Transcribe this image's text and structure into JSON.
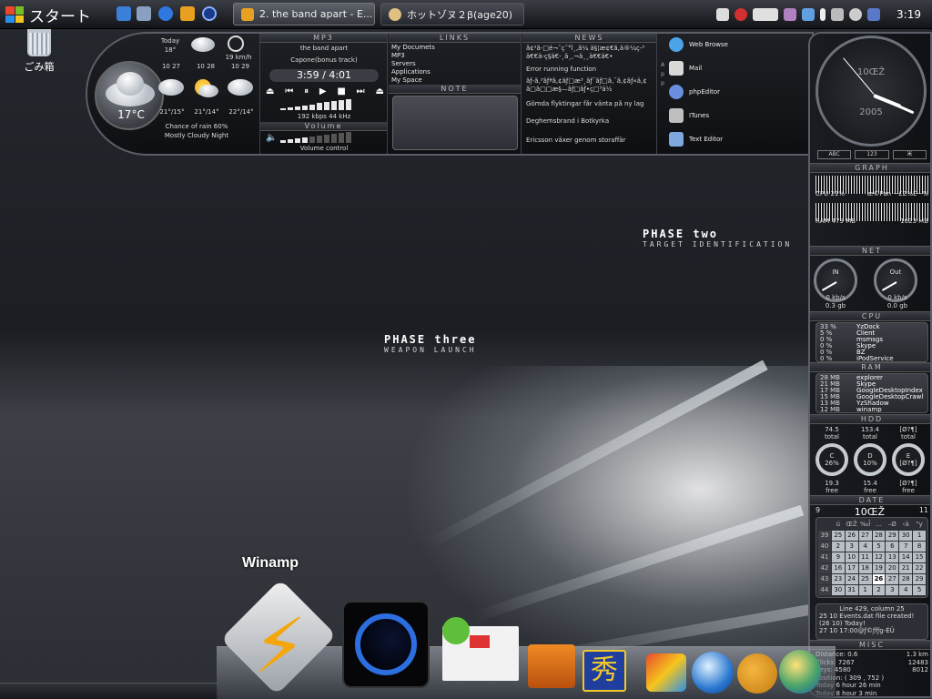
{
  "taskbar": {
    "start_label": "スタート",
    "tasks": [
      {
        "label": "2. the band apart - E...",
        "active": true
      },
      {
        "label": "ホットゾヌ２β(age20)",
        "active": false
      }
    ],
    "clock": "3:19"
  },
  "desktop": {
    "recycle_label": "ごみ箱",
    "phase_two": {
      "title": "PHASE two",
      "sub": "TARGET IDENTIFICATION"
    },
    "phase_three": {
      "title": "PHASE three",
      "sub": "WEAPON LAUNCH"
    }
  },
  "weather": {
    "current_temp": "17°C",
    "today_label": "Today",
    "today_temp": "18°",
    "wind": "19 km/h",
    "forecast_dates": [
      "10 27",
      "10 28",
      "10 29"
    ],
    "forecast_temps": [
      "21°/15°",
      "21°/14°",
      "22°/14°"
    ],
    "chance": "Chance of rain 60%",
    "condition": "Mostly Cloudy Night"
  },
  "mp3": {
    "title": "MP3",
    "artist": "the band apart",
    "track": "Capone(bonus track)",
    "time": "3:59 / 4:01",
    "bitrate": "192 kbps 44 kHz",
    "volume_label": "Volume",
    "volume_control_label": "Volume control",
    "controls": [
      "⏏",
      "⏮",
      "⏸",
      "▶",
      "■",
      "⏭",
      "⏏"
    ]
  },
  "links": {
    "title": "LINKS",
    "items": [
      "My Documets",
      "MP3",
      "Servers",
      "Applications",
      "My Space"
    ],
    "note_title": "NOTE"
  },
  "news": {
    "title": "NEWS",
    "items": [
      "ã¢²ã-□é¬˜ç˜°î¸,ã¼ ä§¦æ¢€ã,ä®¼ç-³ ä€€ä-ç§ä€-¸ä¸,¬ä¸¸ä€€ä€•",
      "Error running function",
      "ãƒ-ã,³ãƒªã,¢ãƒ□æ³¸ãƒ¯ãƒ□ã,¯ã,¢ãƒ«ä,¢ ã□ã□□æ§—ãƒ□ãƒ•ç□³ä½",
      "Gömda flyktingar får vänta på ny lag",
      "Deghemsbrand i Botkyrka",
      "Ericsson växer genom storaffär"
    ]
  },
  "apps": {
    "side_label": "A p p",
    "items": [
      {
        "label": "Web Browse",
        "color": "#4da3e6"
      },
      {
        "label": "Mail",
        "color": "#d8d8d8"
      },
      {
        "label": "phpEditor",
        "color": "#6a8fe0"
      },
      {
        "label": "ITunes",
        "color": "#bfbfbf"
      },
      {
        "label": "Text Editor",
        "color": "#7fa7e0"
      }
    ]
  },
  "sidebar": {
    "clock_date": "10ŒŽ",
    "clock_year": "2005",
    "clock_tabs": [
      "ABC",
      "123",
      "米"
    ],
    "graph_title": "GRAPH",
    "cpu_label": "CPU 21%",
    "cpu_free": "æ©Pan ~£Z%È~%",
    "ram_label": "RAM 479 MB",
    "ram_total": "1023 MB",
    "net_title": "NET",
    "net_in": {
      "label": "IN",
      "rate": "0 kb/s",
      "total": "0.3 gb"
    },
    "net_out": {
      "label": "Out",
      "rate": "0 kb/s",
      "total": "0.0 gb"
    },
    "cpu_title": "CPU",
    "cpu_procs": [
      {
        "pct": "33 %",
        "name": "YzDock"
      },
      {
        "pct": "5 %",
        "name": "Client"
      },
      {
        "pct": "0 %",
        "name": "msmsgs"
      },
      {
        "pct": "0 %",
        "name": "Skype"
      },
      {
        "pct": "0 %",
        "name": "BZ"
      },
      {
        "pct": "0 %",
        "name": "iPodService"
      }
    ],
    "ram_title": "RAM",
    "ram_procs": [
      {
        "pct": "28 MB",
        "name": "explorer"
      },
      {
        "pct": "21 MB",
        "name": "Skype"
      },
      {
        "pct": "17 MB",
        "name": "GoogleDesktopIndex"
      },
      {
        "pct": "15 MB",
        "name": "GoogleDesktopCrawl"
      },
      {
        "pct": "13 MB",
        "name": "YzShadow"
      },
      {
        "pct": "12 MB",
        "name": "winamp"
      }
    ],
    "hdd_title": "HDD",
    "hdd": [
      {
        "drive": "C",
        "pct": "26%",
        "total": "74.5",
        "free": "19.3"
      },
      {
        "drive": "D",
        "pct": "10%",
        "total": "153.4",
        "free": "15.4"
      },
      {
        "drive": "E",
        "pct": "[Ø?¶]",
        "total": "[Ø?¶]",
        "free": "[Ø?¶]"
      }
    ],
    "total_word": "total",
    "free_word": "free",
    "date_title": "DATE",
    "cal_month": "10ŒŽ",
    "cal_prev": "9",
    "cal_next": "11",
    "cal_header": [
      "",
      "ú",
      "ŒŽ",
      "‰Î",
      "…",
      "–Ø",
      "‹à",
      "“y"
    ],
    "cal_rows": [
      [
        "39",
        "25",
        "26",
        "27",
        "28",
        "29",
        "30",
        "1"
      ],
      [
        "40",
        "2",
        "3",
        "4",
        "5",
        "6",
        "7",
        "8"
      ],
      [
        "41",
        "9",
        "10",
        "11",
        "12",
        "13",
        "14",
        "15"
      ],
      [
        "42",
        "16",
        "17",
        "18",
        "19",
        "20",
        "21",
        "22"
      ],
      [
        "43",
        "23",
        "24",
        "25",
        "26",
        "27",
        "28",
        "29"
      ],
      [
        "44",
        "30",
        "31",
        "1",
        "2",
        "3",
        "4",
        "5"
      ]
    ],
    "cal_today": "26",
    "events": [
      "Line 429, column 25",
      "25 10   Events.dat file created!",
      "(26 10)   Today!",
      "27 10   17:00@ƒ©ƒfƒg-ÉÛ"
    ],
    "misc_title": "MISC",
    "misc": [
      {
        "k": "Distance: 0.6",
        "v": "1.3 km"
      },
      {
        "k": "Clicks: 7267",
        "v": "12483"
      },
      {
        "k": "Keys: 4580",
        "v": "8012"
      },
      {
        "k": "Position: ( 309 , 752 )",
        "v": ""
      },
      {
        "k": "Today 6 hour 26 min",
        "v": ""
      },
      {
        "k": "Today 8 hour 3 min",
        "v": ""
      }
    ]
  },
  "dock": {
    "label": "Winamp",
    "icons": [
      "winamp-icon",
      "moon-orb-icon",
      "mail-envelope-icon",
      "folder-icon",
      "hidemaru-icon",
      "x-logo-icon",
      "browser-globe-icon",
      "dog-icon",
      "network-globe-icon"
    ]
  }
}
